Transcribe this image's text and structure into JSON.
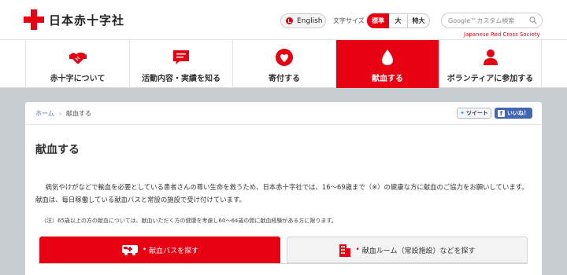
{
  "header": {
    "logo_text": "日本赤十字社",
    "lang_label": "English",
    "fontsize_label": "文字サイズ",
    "fontsize_options": [
      "標準",
      "大",
      "特大"
    ],
    "search_placeholder": "Google™カスタム検索",
    "tagline": "Japanese Red Cross Society"
  },
  "nav": {
    "items": [
      {
        "label": "赤十字について",
        "icon": "handshake-icon"
      },
      {
        "label": "活動内容・実績を知る",
        "icon": "message-icon"
      },
      {
        "label": "寄付する",
        "icon": "heart-icon"
      },
      {
        "label": "献血する",
        "icon": "drop-icon"
      },
      {
        "label": "ボランティアに参加する",
        "icon": "person-icon"
      }
    ],
    "active_index": 3
  },
  "breadcrumb": {
    "home": "ホーム",
    "current": "献血する"
  },
  "social": {
    "tweet": "ツイート",
    "like": "いいね！"
  },
  "page": {
    "title": "献血する",
    "lead": "病気やけがなどで輸血を必要としている患者さんの尊い生命を救うため、日本赤十字社では、16〜69歳まで（※）の健康な方に献血のご協力をお願いしています。献血は、毎日稼働している献血バスと常設の施設で受け付けています。",
    "note": "（注）65歳以上の方の献血については、献血いただく方の健康を考慮し60〜64歳の間に献血経験がある方に限ります。"
  },
  "tabs": [
    {
      "label": "献血バスを探す",
      "icon": "bus-icon"
    },
    {
      "label": "献血ルーム（常設施設）などを探す",
      "icon": "building-icon"
    }
  ],
  "colors": {
    "brand_red": "#e60012",
    "background": "#c8cdd1",
    "facebook": "#4267b2"
  }
}
